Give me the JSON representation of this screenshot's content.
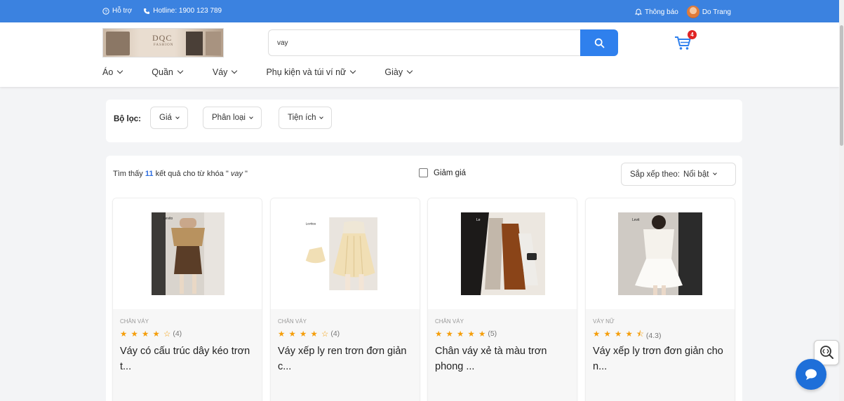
{
  "topbar": {
    "support": "Hỗ trợ",
    "hotline": "Hotline: 1900 123 789",
    "notifications": "Thông báo",
    "user_name": "Do Trang"
  },
  "header": {
    "logo_text": "DQC",
    "logo_sub": "FASHION",
    "search_value": "vay",
    "cart_count": "4",
    "nav": [
      "Áo",
      "Quần",
      "Váy",
      "Phụ kiện và túi ví nữ",
      "Giày"
    ]
  },
  "filter": {
    "label": "Bộ lọc:",
    "buttons": [
      "Giá",
      "Phân loại",
      "Tiện ích"
    ]
  },
  "results": {
    "found_prefix": "Tìm thấy",
    "found_count": "11",
    "found_middle": "kết quả cho từ khóa \"",
    "keyword": "vay",
    "found_suffix": "\"",
    "discount_label": "Giảm giá",
    "sort_label": "Sắp xếp theo:",
    "sort_value": "Nổi bật"
  },
  "products": [
    {
      "category": "CHÂN VÁY",
      "stars": "★ ★ ★ ★ ☆",
      "rating": "(4)",
      "name": "Váy có cấu trúc dây kéo trơn t...",
      "image": "brown-skirt-photo"
    },
    {
      "category": "CHÂN VÁY",
      "stars": "★ ★ ★ ★ ☆",
      "rating": "(4)",
      "name": "Váy xếp ly ren trơn đơn giản c...",
      "image": "cream-skirt-photo"
    },
    {
      "category": "CHÂN VÁY",
      "stars": "★ ★ ★ ★ ★",
      "rating": "(5)",
      "name": "Chân váy xẻ tà màu trơn phong ...",
      "image": "multi-skirt-photo"
    },
    {
      "category": "VÁY NỮ",
      "stars": "★ ★ ★ ★ ⯪",
      "rating": "(4.3)",
      "name": "Váy xếp ly trơn đơn giản cho n...",
      "image": "white-dress-photo"
    }
  ],
  "colors": {
    "topbar": "#3b82e0",
    "search_button": "#2f80ed",
    "stars": "#f59e0b",
    "badge": "#e02424",
    "count": "#2f6fe0"
  }
}
